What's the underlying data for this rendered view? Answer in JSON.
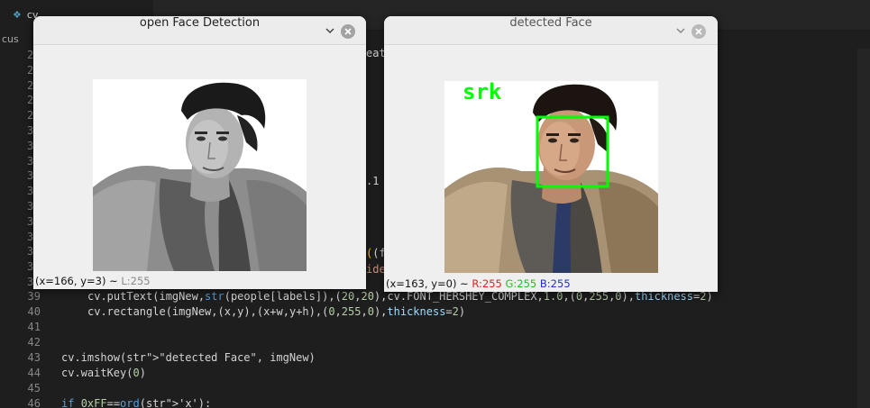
{
  "editor": {
    "tabs": [
      {
        "label": "cv"
      },
      {
        "label": ""
      }
    ],
    "breadcrumb": "cus",
    "fragments": {
      "line_a": "eat",
      "line_b": ".1",
      "line_c": "(fa",
      "line_d": "ide"
    },
    "hidden_line_numbers": [
      "2",
      "2",
      "2",
      "2",
      "2",
      "3",
      "3",
      "3",
      "3",
      "3",
      "3",
      "3",
      "3",
      "3",
      "3",
      "3"
    ],
    "lines": [
      {
        "num": "39",
        "indent": "    ",
        "text": "cv.putText(imgNew,str(people[labels]),(20,20),cv.FONT_HERSHEY_COMPLEX,1.0,(0,255,0),thickness=2)"
      },
      {
        "num": "40",
        "indent": "    ",
        "text": "cv.rectangle(imgNew,(x,y),(x+w,y+h),(0,255,0),thickness=2)"
      },
      {
        "num": "41",
        "indent": "",
        "text": ""
      },
      {
        "num": "42",
        "indent": "",
        "text": ""
      },
      {
        "num": "43",
        "indent": "",
        "text": "cv.imshow(\"detected Face\", imgNew)"
      },
      {
        "num": "44",
        "indent": "",
        "text": "cv.waitKey(0)"
      },
      {
        "num": "45",
        "indent": "",
        "text": ""
      },
      {
        "num": "46",
        "indent": "",
        "text": "if 0xFF==ord('x'):"
      }
    ]
  },
  "windows": {
    "open": {
      "title": "open Face Detection",
      "status": {
        "coords": "(x=166, y=3) ~ ",
        "luminance": "L:255"
      }
    },
    "detected": {
      "title": "detected Face",
      "label_text": "srk",
      "status": {
        "coords": "(x=163, y=0) ~ ",
        "r": "R:255",
        "g": "G:255",
        "b": "B:255"
      }
    }
  },
  "colors": {
    "detection_box": "#00ff00",
    "label_text": "#00ff00"
  }
}
